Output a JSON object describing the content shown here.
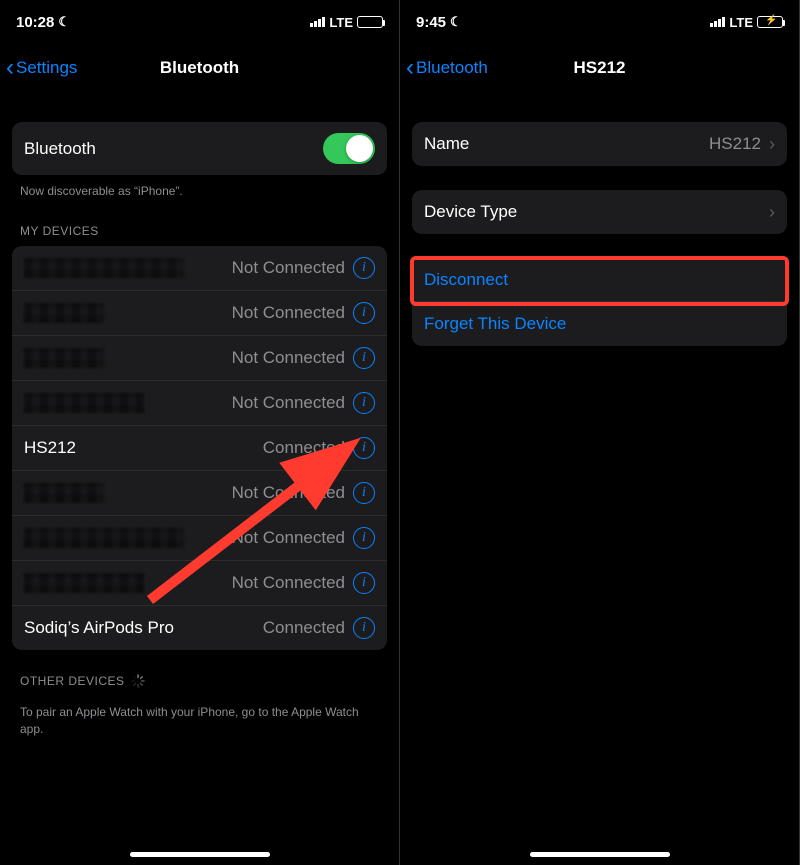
{
  "left": {
    "status": {
      "time": "10:28",
      "network": "LTE"
    },
    "nav": {
      "back": "Settings",
      "title": "Bluetooth"
    },
    "bluetooth_row": {
      "label": "Bluetooth"
    },
    "discoverable_text": "Now discoverable as “iPhone”.",
    "my_devices_header": "MY DEVICES",
    "not_connected": "Not Connected",
    "connected": "Connected",
    "devices": [
      {
        "name": "",
        "status": "Not Connected",
        "redacted": true
      },
      {
        "name": "",
        "status": "Not Connected",
        "redacted": true
      },
      {
        "name": "",
        "status": "Not Connected",
        "redacted": true
      },
      {
        "name": "",
        "status": "Not Connected",
        "redacted": true
      },
      {
        "name": "HS212",
        "status": "Connected",
        "redacted": false
      },
      {
        "name": "",
        "status": "Not Connected",
        "redacted": true
      },
      {
        "name": "",
        "status": "Not Connected",
        "redacted": true
      },
      {
        "name": "",
        "status": "Not Connected",
        "redacted": true
      },
      {
        "name": "Sodiq’s AirPods Pro",
        "status": "Connected",
        "redacted": false
      }
    ],
    "other_devices_header": "OTHER DEVICES",
    "pairing_hint": "To pair an Apple Watch with your iPhone, go to the ",
    "pairing_link": "Apple Watch app",
    "pairing_hint_end": "."
  },
  "right": {
    "status": {
      "time": "9:45",
      "network": "LTE"
    },
    "nav": {
      "back": "Bluetooth",
      "title": "HS212"
    },
    "name_row": {
      "label": "Name",
      "value": "HS212"
    },
    "device_type_row": {
      "label": "Device Type"
    },
    "disconnect": "Disconnect",
    "forget": "Forget This Device"
  }
}
